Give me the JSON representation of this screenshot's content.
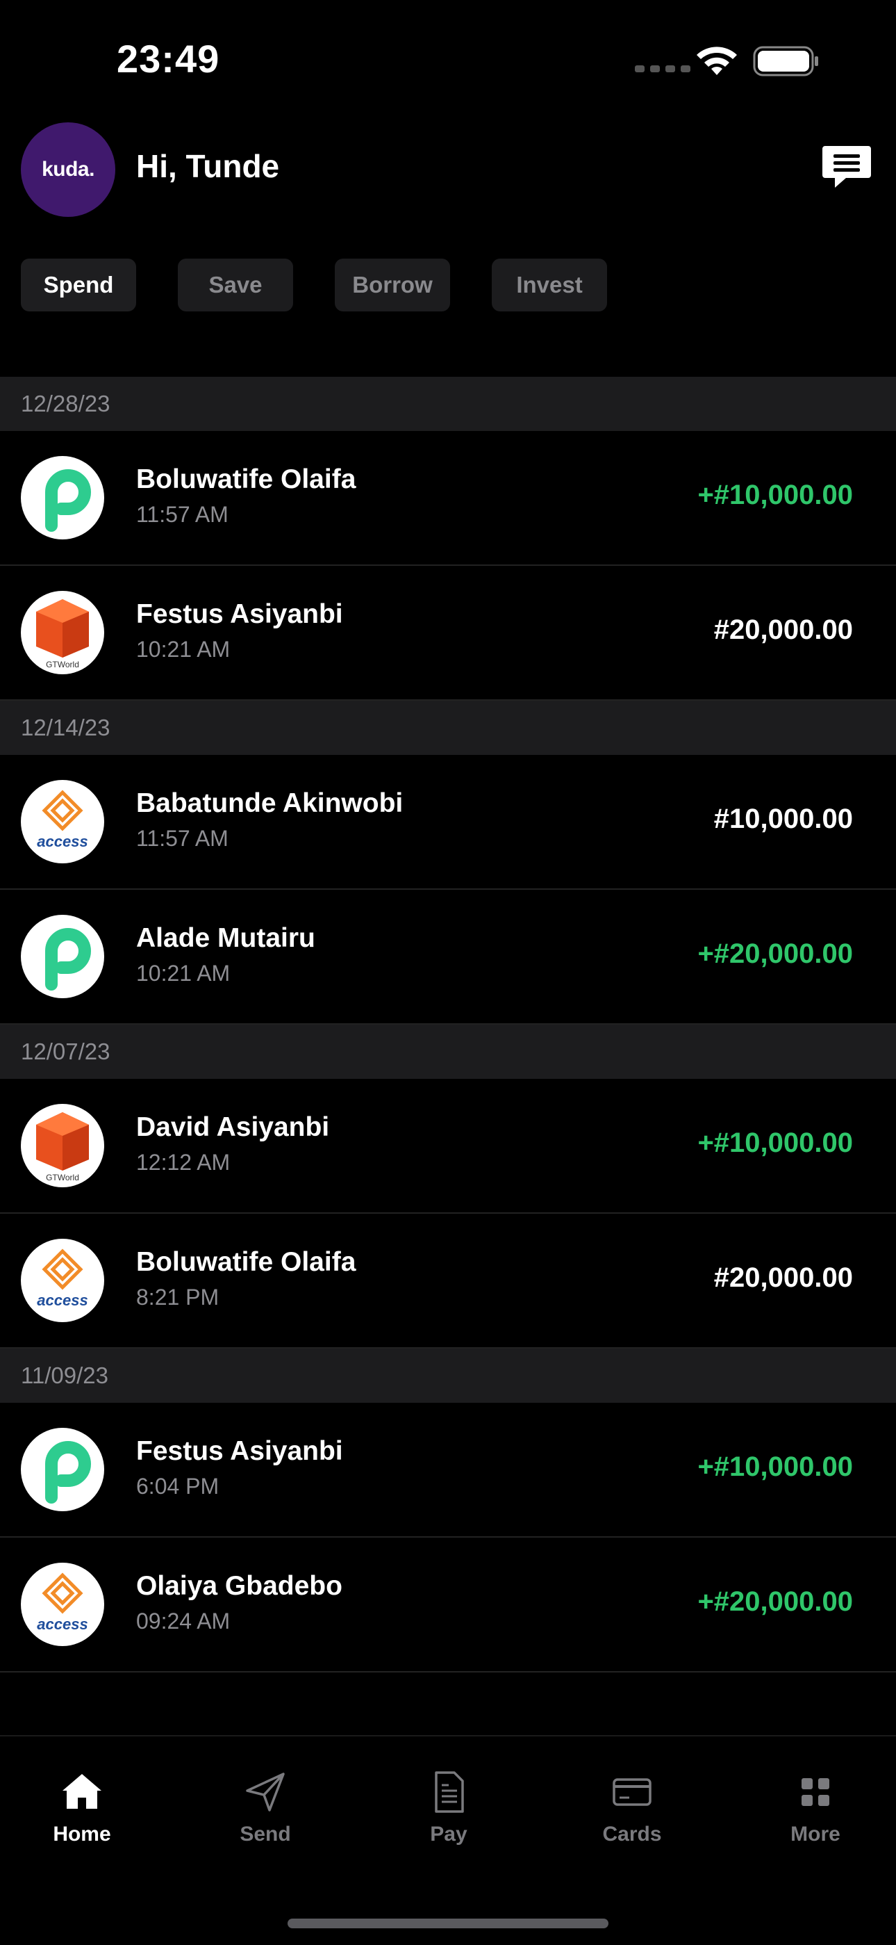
{
  "status_bar": {
    "time": "23:49"
  },
  "header": {
    "brand": "kuda.",
    "greeting": "Hi, Tunde"
  },
  "tabs": [
    {
      "label": "Spend",
      "active": true
    },
    {
      "label": "Save",
      "active": false
    },
    {
      "label": "Borrow",
      "active": false
    },
    {
      "label": "Invest",
      "active": false
    }
  ],
  "groups": [
    {
      "date": "12/28/23",
      "transactions": [
        {
          "name": "Boluwatife Olaifa",
          "time": "11:57 AM",
          "amount": "+#10,000.00",
          "type": "credit",
          "bank": "p-green"
        },
        {
          "name": "Festus Asiyanbi",
          "time": "10:21 AM",
          "amount": "#20,000.00",
          "type": "debit",
          "bank": "gtworld"
        }
      ]
    },
    {
      "date": "12/14/23",
      "transactions": [
        {
          "name": "Babatunde Akinwobi",
          "time": "11:57 AM",
          "amount": "#10,000.00",
          "type": "debit",
          "bank": "access"
        },
        {
          "name": "Alade Mutairu",
          "time": "10:21 AM",
          "amount": "+#20,000.00",
          "type": "credit",
          "bank": "p-green"
        }
      ]
    },
    {
      "date": "12/07/23",
      "transactions": [
        {
          "name": "David Asiyanbi",
          "time": "12:12 AM",
          "amount": "+#10,000.00",
          "type": "credit",
          "bank": "gtworld"
        },
        {
          "name": "Boluwatife Olaifa",
          "time": "8:21 PM",
          "amount": "#20,000.00",
          "type": "debit",
          "bank": "access"
        }
      ]
    },
    {
      "date": "11/09/23",
      "transactions": [
        {
          "name": "Festus Asiyanbi",
          "time": "6:04 PM",
          "amount": "+#10,000.00",
          "type": "credit",
          "bank": "p-green"
        },
        {
          "name": "Olaiya Gbadebo",
          "time": "09:24 AM",
          "amount": "+#20,000.00",
          "type": "credit",
          "bank": "access"
        }
      ]
    }
  ],
  "bank_labels": {
    "gtworld": "GTWorld",
    "access": "access"
  },
  "nav": [
    {
      "label": "Home",
      "icon": "home-icon",
      "active": true
    },
    {
      "label": "Send",
      "icon": "send-icon",
      "active": false
    },
    {
      "label": "Pay",
      "icon": "pay-icon",
      "active": false
    },
    {
      "label": "Cards",
      "icon": "cards-icon",
      "active": false
    },
    {
      "label": "More",
      "icon": "more-icon",
      "active": false
    }
  ],
  "colors": {
    "credit": "#2fc66a",
    "brand": "#40196d",
    "access": "#f28c28",
    "gtworld": "#e8501e",
    "p_green": "#2ecc8f"
  }
}
